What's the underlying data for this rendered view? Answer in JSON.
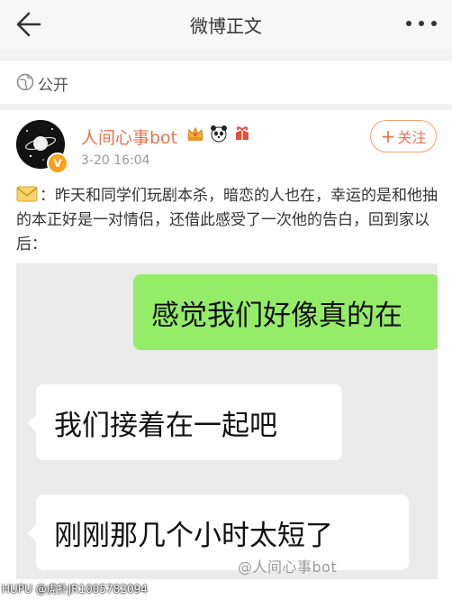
{
  "header": {
    "title": "微博正文"
  },
  "visibility": {
    "label": "公开"
  },
  "author": {
    "name": "人间心事bot",
    "time": "3-20 16:04",
    "verified_badge": "V",
    "follow_label": "关注"
  },
  "post": {
    "text": "：昨天和同学们玩剧本杀，暗恋的人也在，幸运的是和他抽的本正好是一对情侣，还借此感受了一次他的告白，回到家以后："
  },
  "image": {
    "messages": [
      {
        "side": "right",
        "text": "感觉我们好像真的在"
      },
      {
        "side": "left",
        "text": "我们接着在一起吧"
      },
      {
        "side": "left",
        "text": "刚刚那几个小时太短了"
      }
    ]
  },
  "watermark": {
    "text": "@人间心事bot",
    "bottom_text": "HUPU @虎扑JR1005782094"
  },
  "colors": {
    "accent": "#eb7350",
    "bubble_green": "#95ec69",
    "header_bg": "#f7f7f7"
  }
}
